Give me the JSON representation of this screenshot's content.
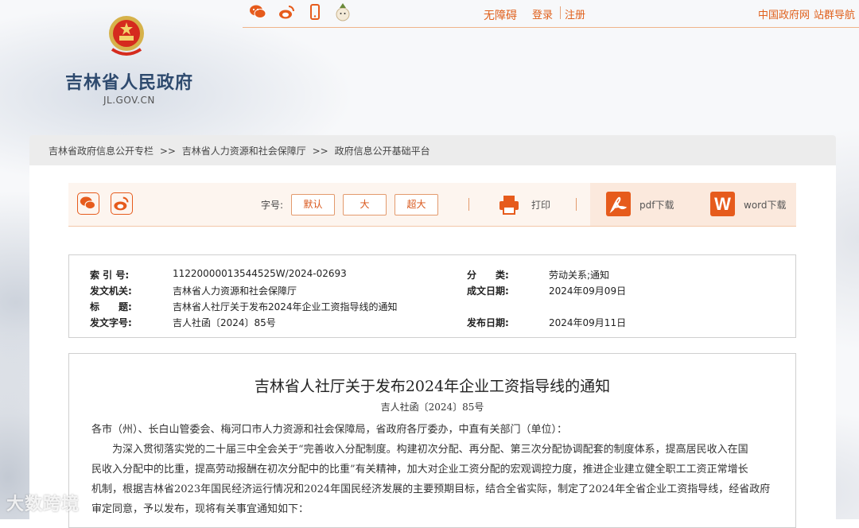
{
  "header": {
    "accessibility": "无障碍",
    "login": "登录",
    "register": "注册",
    "china_gov": "中国政府网",
    "site_nav": "站群导航",
    "icons": [
      "wechat-icon",
      "weibo-icon",
      "mobile-icon",
      "mascot-icon"
    ]
  },
  "logo": {
    "name": "吉林省人民政府",
    "domain": "JL.GOV.CN"
  },
  "breadcrumb": {
    "items": [
      "吉林省政府信息公开专栏",
      "吉林省人力资源和社会保障厅",
      "政府信息公开基础平台"
    ],
    "separator": ">>"
  },
  "toolbar": {
    "font_label": "字号:",
    "font_sizes": [
      "默认",
      "大",
      "超大"
    ],
    "print": "打印",
    "pdf": "pdf下载",
    "word": "word下载"
  },
  "meta": {
    "index_label": "索 引 号:",
    "index_value": "11220000013544525W/2024-02693",
    "category_label": "分　　类:",
    "category_value": "劳动关系;通知",
    "issuer_label": "发文机关:",
    "issuer_value": "吉林省人力资源和社会保障厅",
    "created_label": "成文日期:",
    "created_value": "2024年09月09日",
    "title_label": "标　　题:",
    "title_value": "吉林省人社厅关于发布2024年企业工资指导线的通知",
    "docno_label": "发文字号:",
    "docno_value": "吉人社函〔2024〕85号",
    "published_label": "发布日期:",
    "published_value": "2024年09月11日"
  },
  "article": {
    "title": "吉林省人社厅关于发布2024年企业工资指导线的通知",
    "doc_number": "吉人社函〔2024〕85号",
    "salutation": "各市（州）、长白山管委会、梅河口市人力资源和社会保障局，省政府各厅委办，中直有关部门（单位）：",
    "para1_line1": "为深入贯彻落实党的二十届三中全会关于“完善收入分配制度。构建初次分配、再分配、第三次分配协调配套的制度体系，提高居民收入在国",
    "para1_line2": "民收入分配中的比重，提高劳动报酬在初次分配中的比重”有关精神，加大对企业工资分配的宏观调控力度，推进企业建立健全职工工资正常增长",
    "para1_line3": "机制，根据吉林省2023年国民经济运行情况和2024年国民经济发展的主要预期目标，结合全省实际，制定了2024年全省企业工资指导线，经省政府",
    "para1_line4": "审定同意，予以发布，现将有关事宜通知如下："
  },
  "watermark": "大数跨境",
  "colors": {
    "accent": "#e65b1c",
    "brand_blue": "#2e4a6e"
  }
}
